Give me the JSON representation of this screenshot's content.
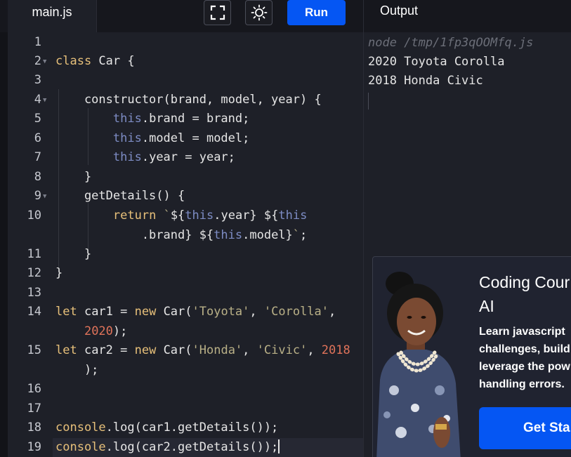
{
  "editor": {
    "tab_label": "main.js",
    "run_label": "Run",
    "line_numbers": [
      "1",
      "2",
      "3",
      "4",
      "5",
      "6",
      "7",
      "8",
      "9",
      "10",
      "11",
      "12",
      "13",
      "14",
      "15",
      "16",
      "17",
      "18",
      "19"
    ]
  },
  "output": {
    "title": "Output",
    "command": "node /tmp/1fp3qOOMfq.js",
    "lines": [
      "2020 Toyota Corolla",
      "2018 Honda Civic"
    ]
  },
  "ad": {
    "title_line1": "Coding Cour",
    "title_line2": "AI",
    "desc_lines": [
      "Learn javascript",
      "challenges, build",
      "leverage the pow",
      "handling errors."
    ],
    "cta_label": "Get Sta"
  },
  "colors": {
    "run_button": "#0556f3",
    "keyword": "#e7c07a",
    "this_keyword": "#7d8cc4",
    "string": "#b9b087",
    "number": "#e0735a"
  },
  "icons": {
    "fullscreen": "fullscreen-icon",
    "theme": "sun-icon"
  }
}
